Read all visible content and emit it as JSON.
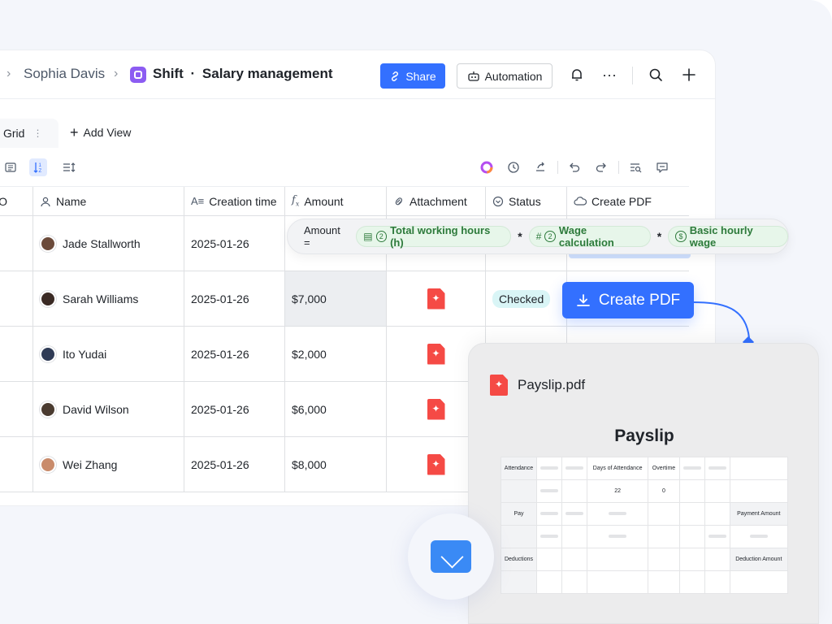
{
  "breadcrumb": {
    "user": "Sophia Davis"
  },
  "app": {
    "name": "Shift",
    "separator": "·",
    "table": "Salary management"
  },
  "header": {
    "share_label": "Share",
    "automation_label": "Automation",
    "more_icon": "···"
  },
  "views": {
    "active": "Grid",
    "add_label": "Add View"
  },
  "columns": {
    "no": "NO",
    "name": "Name",
    "created": "Creation time",
    "amount": "Amount",
    "attachment": "Attachment",
    "status": "Status",
    "create_pdf": "Create PDF"
  },
  "rows": [
    {
      "name": "Jade Stallworth",
      "date": "2025-01-26",
      "amount": "",
      "attachment": false,
      "status": "",
      "avatar_color": "#6b4a3a"
    },
    {
      "name": "Sarah Williams",
      "date": "2025-01-26",
      "amount": "$7,000",
      "attachment": true,
      "status": "Checked",
      "avatar_color": "#3a2a24"
    },
    {
      "name": "Ito Yudai",
      "date": "2025-01-26",
      "amount": "$2,000",
      "attachment": true,
      "status": "",
      "avatar_color": "#2f3b55"
    },
    {
      "name": "David Wilson",
      "date": "2025-01-26",
      "amount": "$6,000",
      "attachment": true,
      "status": "",
      "avatar_color": "#4a3b30"
    },
    {
      "name": "Wei Zhang",
      "date": "2025-01-26",
      "amount": "$8,000",
      "attachment": true,
      "status": "",
      "avatar_color": "#c98b6b"
    }
  ],
  "formula": {
    "lead": "Amount =",
    "op1": "*",
    "op2": "*",
    "chip1": {
      "label": "Total working hours (h)",
      "icon": "formula-icon",
      "num": "2"
    },
    "chip2": {
      "label": "Wage calculation",
      "icon": "#",
      "num": "2"
    },
    "chip3": {
      "label": "Basic hourly wage",
      "icon": "$"
    }
  },
  "cta": {
    "label": "Create PDF"
  },
  "payslip": {
    "filename": "Payslip.pdf",
    "title": "Payslip",
    "attendance": "Attendance",
    "days_label": "Days of Attendance",
    "overtime_label": "Overtime",
    "days_value": "22",
    "overtime_value": "0",
    "pay": "Pay",
    "payment_amount": "Payment Amount",
    "deductions": "Deductions",
    "deduction_amount": "Deduction Amount"
  },
  "colors": {
    "accent": "#3370ff",
    "pdf_red": "#f54a45",
    "chip_green": "#2d7a3b",
    "status_tag": "#d9f5f6"
  }
}
